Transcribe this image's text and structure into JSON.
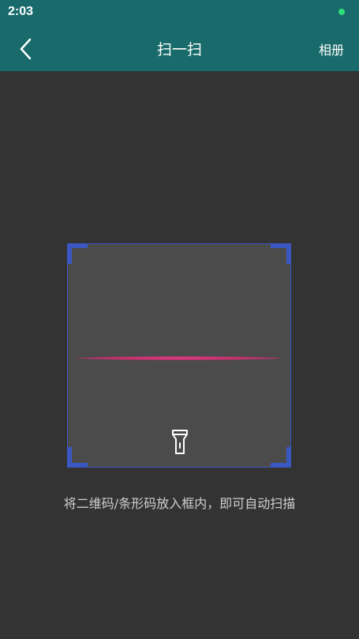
{
  "status_bar": {
    "time": "2:03",
    "indicator_color": "#2ee07a"
  },
  "header": {
    "title": "扫一扫",
    "album_label": "相册",
    "back_icon": "chevron-left-icon",
    "background_color": "#196b6b"
  },
  "scanner": {
    "frame_color": "#3a57c4",
    "scan_line_color": "#d8407c",
    "flashlight_icon": "flashlight-icon"
  },
  "hint": {
    "text": "将二维码/条形码放入框内，即可自动扫描"
  }
}
